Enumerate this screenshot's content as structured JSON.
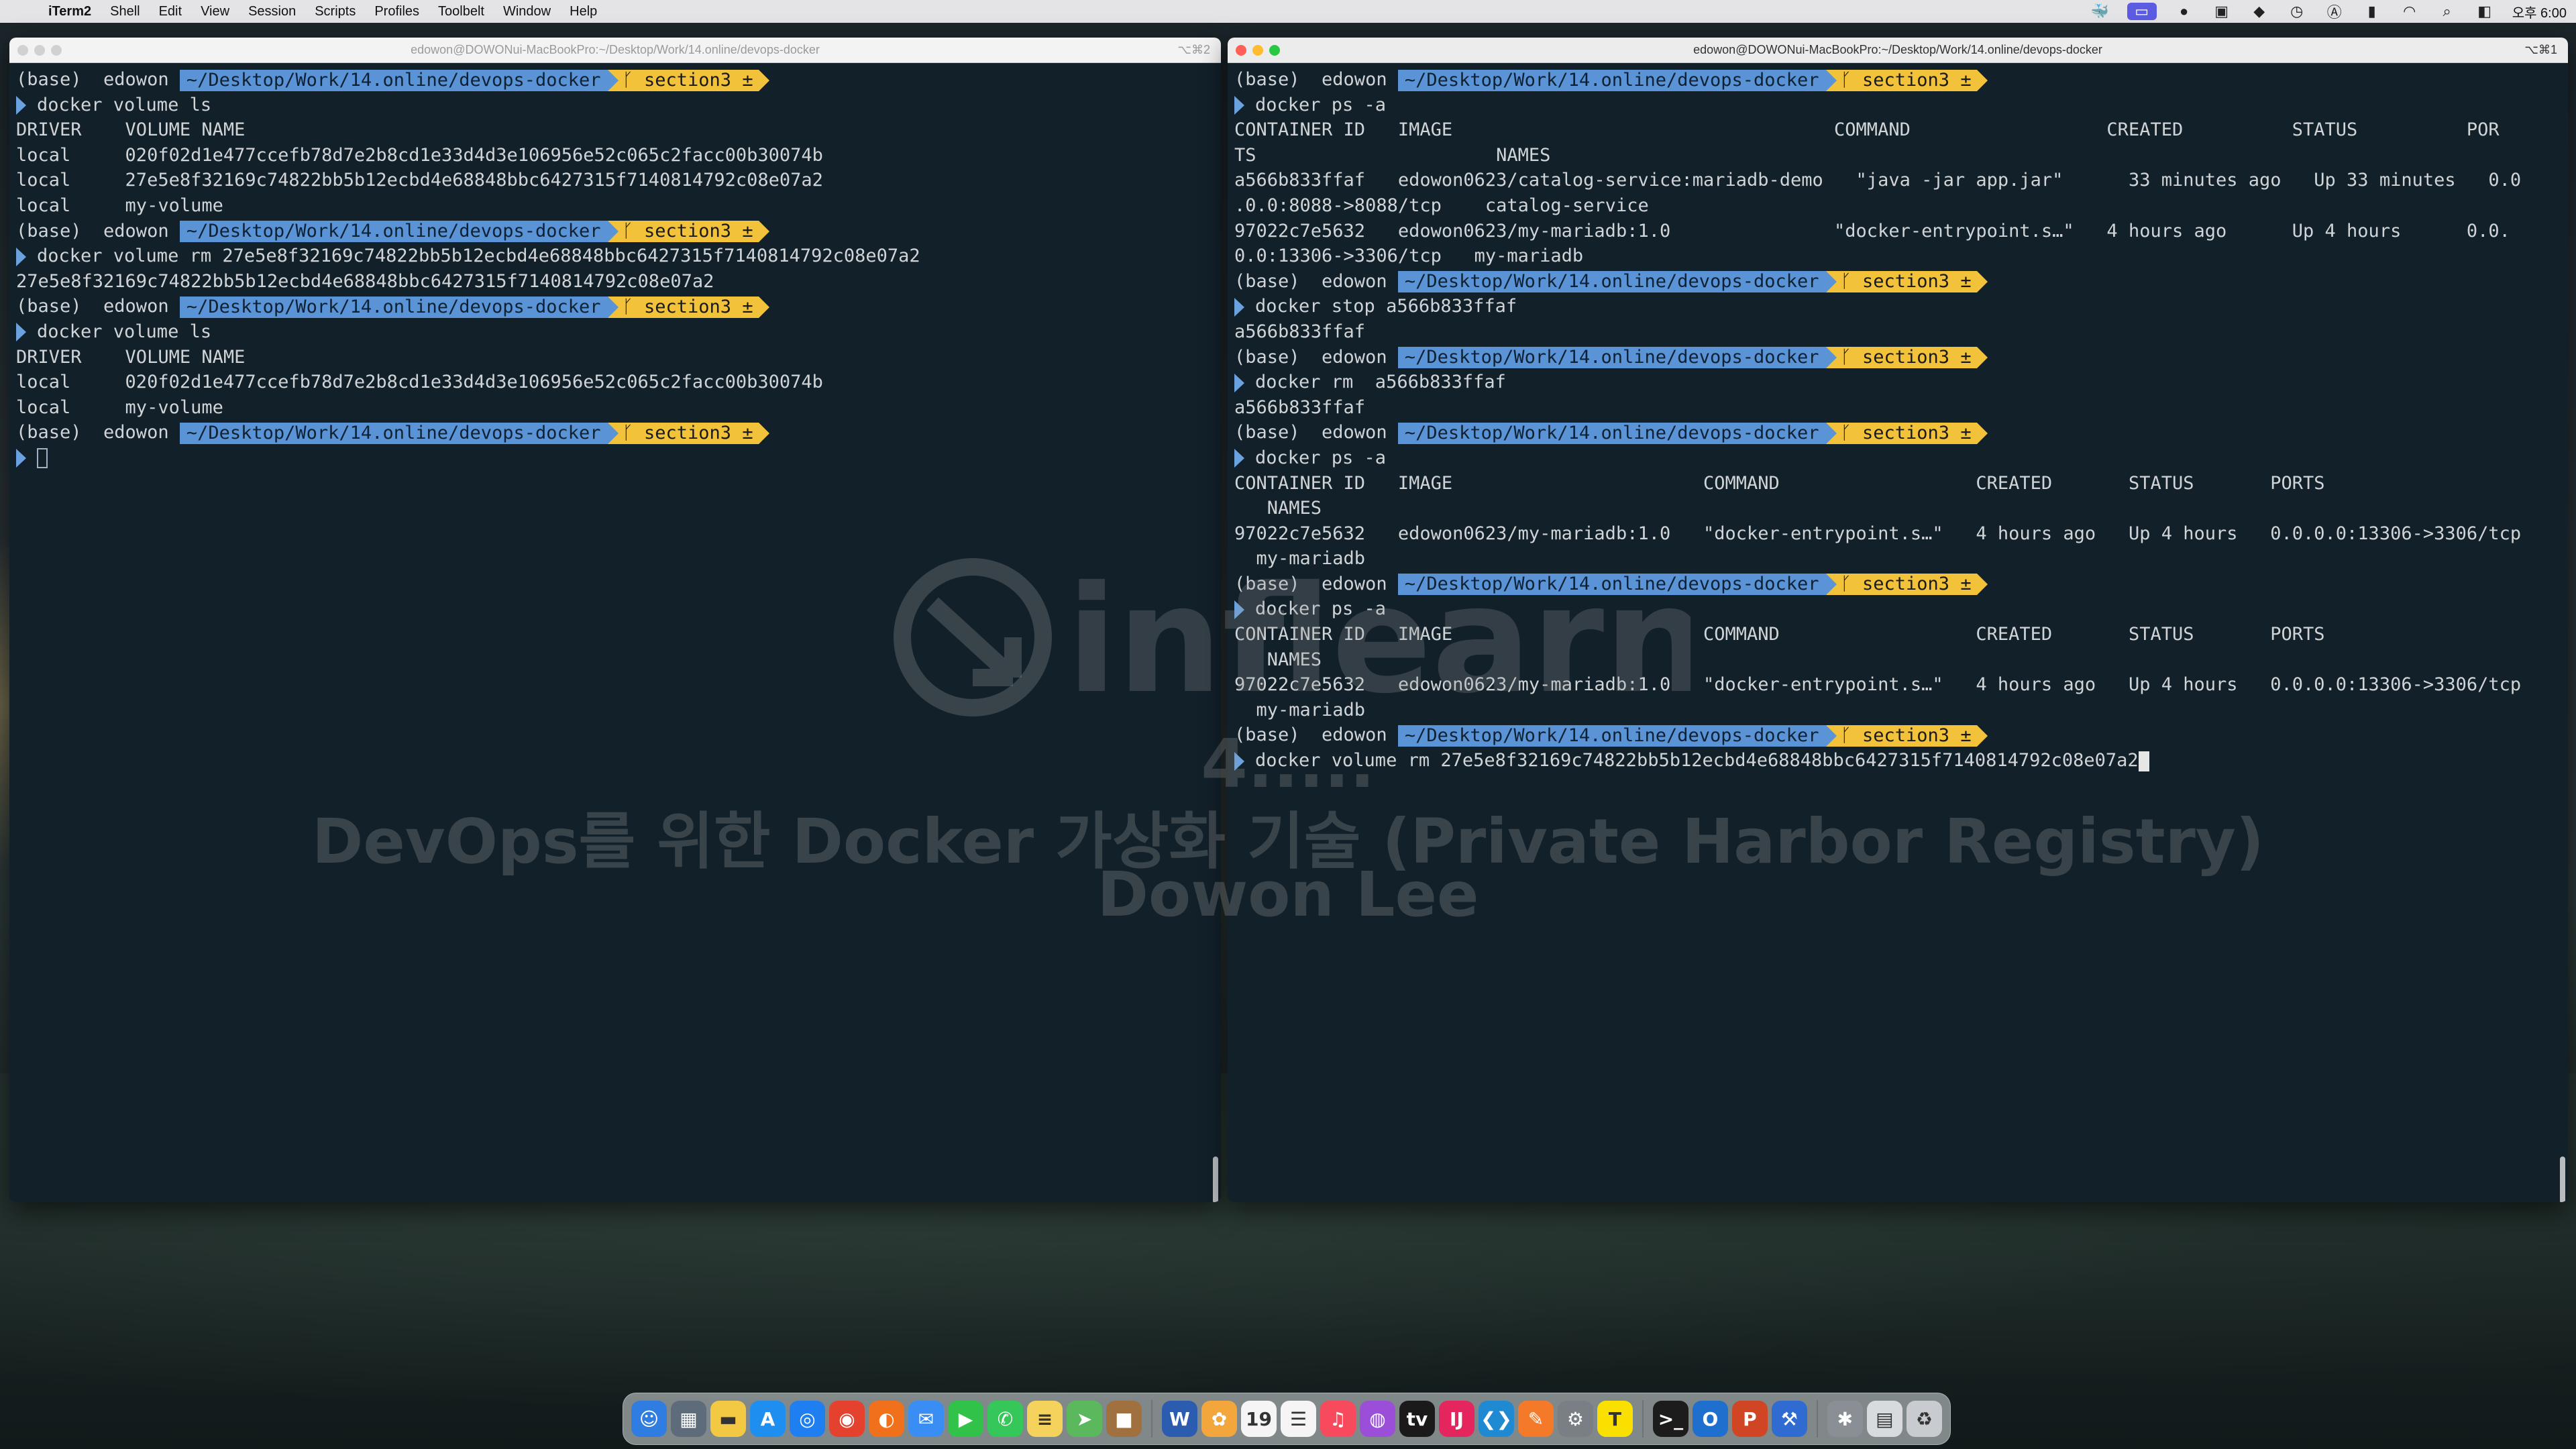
{
  "menubar": {
    "app_name": "iTerm2",
    "items": [
      "Shell",
      "Edit",
      "View",
      "Session",
      "Scripts",
      "Profiles",
      "Toolbelt",
      "Window",
      "Help"
    ],
    "clock": "오후 6:00"
  },
  "left_window": {
    "title": "edowon@DOWONui-MacBookPro:~/Desktop/Work/14.online/devops-docker",
    "shortcut": "⌥⌘2",
    "lines": [
      {
        "type": "prompt",
        "base": "(base)  edowon ",
        "path": "~/Desktop/Work/14.online/devops-docker",
        "git": "ᚴ section3 ±"
      },
      {
        "type": "cmd",
        "text": "docker volume ls"
      },
      {
        "type": "out",
        "text": "DRIVER    VOLUME NAME"
      },
      {
        "type": "out",
        "text": "local     020f02d1e477ccefb78d7e2b8cd1e33d4d3e106956e52c065c2facc00b30074b"
      },
      {
        "type": "out",
        "text": "local     27e5e8f32169c74822bb5b12ecbd4e68848bbc6427315f7140814792c08e07a2"
      },
      {
        "type": "out",
        "text": "local     my-volume"
      },
      {
        "type": "prompt",
        "base": "(base)  edowon ",
        "path": "~/Desktop/Work/14.online/devops-docker",
        "git": "ᚴ section3 ±"
      },
      {
        "type": "cmd",
        "text": "docker volume rm 27e5e8f32169c74822bb5b12ecbd4e68848bbc6427315f7140814792c08e07a2"
      },
      {
        "type": "out",
        "text": "27e5e8f32169c74822bb5b12ecbd4e68848bbc6427315f7140814792c08e07a2"
      },
      {
        "type": "prompt",
        "base": "(base)  edowon ",
        "path": "~/Desktop/Work/14.online/devops-docker",
        "git": "ᚴ section3 ±"
      },
      {
        "type": "cmd",
        "text": "docker volume ls"
      },
      {
        "type": "out",
        "text": "DRIVER    VOLUME NAME"
      },
      {
        "type": "out",
        "text": "local     020f02d1e477ccefb78d7e2b8cd1e33d4d3e106956e52c065c2facc00b30074b"
      },
      {
        "type": "out",
        "text": "local     my-volume"
      },
      {
        "type": "prompt",
        "base": "(base)  edowon ",
        "path": "~/Desktop/Work/14.online/devops-docker",
        "git": "ᚴ section3 ±"
      },
      {
        "type": "cursor-empty"
      }
    ]
  },
  "right_window": {
    "title": "edowon@DOWONui-MacBookPro:~/Desktop/Work/14.online/devops-docker",
    "shortcut": "⌥⌘1",
    "lines": [
      {
        "type": "prompt",
        "base": "(base)  edowon ",
        "path": "~/Desktop/Work/14.online/devops-docker",
        "git": "ᚴ section3 ±"
      },
      {
        "type": "cmd",
        "text": "docker ps -a"
      },
      {
        "type": "out",
        "text": "CONTAINER ID   IMAGE                                   COMMAND                  CREATED          STATUS          POR"
      },
      {
        "type": "out",
        "text": "TS                      NAMES"
      },
      {
        "type": "out",
        "text": "a566b833ffaf   edowon0623/catalog-service:mariadb-demo   \"java -jar app.jar\"      33 minutes ago   Up 33 minutes   0.0"
      },
      {
        "type": "out",
        "text": ".0.0:8088->8088/tcp    catalog-service"
      },
      {
        "type": "out",
        "text": "97022c7e5632   edowon0623/my-mariadb:1.0               \"docker-entrypoint.s…\"   4 hours ago      Up 4 hours      0.0."
      },
      {
        "type": "out",
        "text": "0.0:13306->3306/tcp   my-mariadb"
      },
      {
        "type": "prompt",
        "base": "(base)  edowon ",
        "path": "~/Desktop/Work/14.online/devops-docker",
        "git": "ᚴ section3 ±"
      },
      {
        "type": "cmd",
        "text": "docker stop a566b833ffaf"
      },
      {
        "type": "out",
        "text": "a566b833ffaf"
      },
      {
        "type": "prompt",
        "base": "(base)  edowon ",
        "path": "~/Desktop/Work/14.online/devops-docker",
        "git": "ᚴ section3 ±"
      },
      {
        "type": "cmd",
        "text": "docker rm  a566b833ffaf"
      },
      {
        "type": "out",
        "text": "a566b833ffaf"
      },
      {
        "type": "prompt",
        "base": "(base)  edowon ",
        "path": "~/Desktop/Work/14.online/devops-docker",
        "git": "ᚴ section3 ±"
      },
      {
        "type": "cmd",
        "text": "docker ps -a"
      },
      {
        "type": "out",
        "text": "CONTAINER ID   IMAGE                       COMMAND                  CREATED       STATUS       PORTS"
      },
      {
        "type": "out",
        "text": "   NAMES"
      },
      {
        "type": "out",
        "text": "97022c7e5632   edowon0623/my-mariadb:1.0   \"docker-entrypoint.s…\"   4 hours ago   Up 4 hours   0.0.0.0:13306->3306/tcp"
      },
      {
        "type": "out",
        "text": "  my-mariadb"
      },
      {
        "type": "prompt",
        "base": "(base)  edowon ",
        "path": "~/Desktop/Work/14.online/devops-docker",
        "git": "ᚴ section3 ±"
      },
      {
        "type": "cmd",
        "text": "docker ps -a"
      },
      {
        "type": "out",
        "text": "CONTAINER ID   IMAGE                       COMMAND                  CREATED       STATUS       PORTS"
      },
      {
        "type": "out",
        "text": "   NAMES"
      },
      {
        "type": "out",
        "text": "97022c7e5632   edowon0623/my-mariadb:1.0   \"docker-entrypoint.s…\"   4 hours ago   Up 4 hours   0.0.0.0:13306->3306/tcp"
      },
      {
        "type": "out",
        "text": "  my-mariadb"
      },
      {
        "type": "prompt",
        "base": "(base)  edowon ",
        "path": "~/Desktop/Work/14.online/devops-docker",
        "git": "ᚴ section3 ±"
      },
      {
        "type": "cmd-cursor",
        "text": "docker volume rm 27e5e8f32169c74822bb5b12ecbd4e68848bbc6427315f7140814792c08e07a2"
      }
    ]
  },
  "watermark": {
    "brand": "inflearn",
    "course_id": "4.....",
    "course": "DevOps를 위한 Docker 가상화 기술 (Private Harbor Registry)",
    "author": "Dowon Lee"
  },
  "dock": {
    "icons": [
      {
        "name": "finder-icon",
        "glyph": "☺",
        "color": "#2f7de1"
      },
      {
        "name": "launchpad-icon",
        "glyph": "▦",
        "color": "#5d6b7a"
      },
      {
        "name": "notes-folder-icon",
        "glyph": "▬",
        "color": "#f3c843"
      },
      {
        "name": "app-store-icon",
        "glyph": "A",
        "color": "#1e8ef0"
      },
      {
        "name": "safari-icon",
        "glyph": "◎",
        "color": "#1f7ff0"
      },
      {
        "name": "chrome-icon",
        "glyph": "◉",
        "color": "#e4412f"
      },
      {
        "name": "firefox-icon",
        "glyph": "◐",
        "color": "#f0701c"
      },
      {
        "name": "mail-icon",
        "glyph": "✉",
        "color": "#3a8ef3"
      },
      {
        "name": "facetime-icon",
        "glyph": "▶",
        "color": "#31c24a"
      },
      {
        "name": "messages-icon",
        "glyph": "✆",
        "color": "#35c759"
      },
      {
        "name": "notes-icon",
        "glyph": "≡",
        "color": "#f4d25c"
      },
      {
        "name": "maps-icon",
        "glyph": "➤",
        "color": "#5bb85c"
      },
      {
        "name": "brown-app-icon",
        "glyph": "■",
        "color": "#a0713f"
      },
      {
        "name": "word-icon",
        "glyph": "W",
        "color": "#2b5caf"
      },
      {
        "name": "photos-icon",
        "glyph": "✿",
        "color": "#f2a63b"
      },
      {
        "name": "calendar-icon",
        "glyph": "19",
        "color": "#f5f5f5"
      },
      {
        "name": "reminders-icon",
        "glyph": "☰",
        "color": "#f5f5f5"
      },
      {
        "name": "music-icon",
        "glyph": "♫",
        "color": "#f74a5c"
      },
      {
        "name": "podcasts-icon",
        "glyph": "◍",
        "color": "#9b4fd8"
      },
      {
        "name": "apple-tv-icon",
        "glyph": "tv",
        "color": "#1a1a1a"
      },
      {
        "name": "intellij-icon",
        "glyph": "IJ",
        "color": "#e5265e"
      },
      {
        "name": "vscode-icon",
        "glyph": "❮❯",
        "color": "#1f8ad2"
      },
      {
        "name": "swift-playground-icon",
        "glyph": "✎",
        "color": "#f47a2a"
      },
      {
        "name": "system-preferences-icon",
        "glyph": "⚙",
        "color": "#7a7f86"
      },
      {
        "name": "kakaotalk-icon",
        "glyph": "T",
        "color": "#f9e000"
      },
      {
        "name": "terminal-icon",
        "glyph": ">_",
        "color": "#1c1c1c"
      },
      {
        "name": "outlook-icon",
        "glyph": "O",
        "color": "#1f6fce"
      },
      {
        "name": "powerpoint-icon",
        "glyph": "P",
        "color": "#d04523"
      },
      {
        "name": "xcode-icon",
        "glyph": "⚒",
        "color": "#2f6bd1"
      },
      {
        "name": "gear-app-icon",
        "glyph": "✱",
        "color": "#8a8f96"
      },
      {
        "name": "downloads-icon",
        "glyph": "▤",
        "color": "#d8dbde"
      },
      {
        "name": "trash-icon",
        "glyph": "♻",
        "color": "#c8ccd0"
      }
    ]
  }
}
